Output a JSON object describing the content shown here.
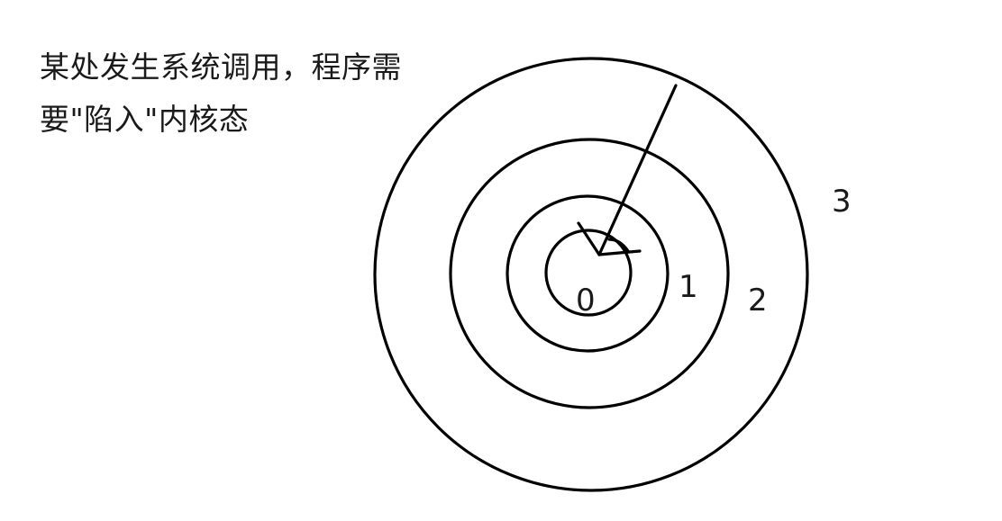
{
  "caption": {
    "line1": "某处发生系统调用，程序需",
    "line2": "要\"陷入\"内核态"
  },
  "rings": {
    "labels": [
      "0",
      "1",
      "2",
      "3"
    ]
  },
  "colors": {
    "ink": "#000000",
    "background": "#ffffff"
  }
}
